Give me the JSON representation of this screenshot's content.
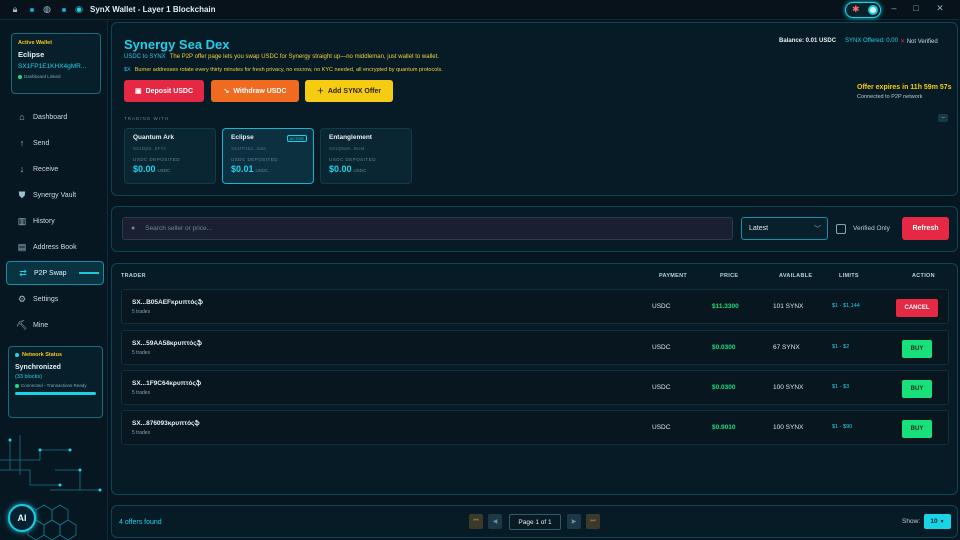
{
  "window": {
    "title": "SynX Wallet - Layer 1 Blockchain",
    "controls": [
      "–",
      "□",
      "✕"
    ]
  },
  "sidebar": {
    "wallet": {
      "label": "Active Wallet",
      "name": "Eclipse",
      "address": "SX1FP1E1KHX4gMR...",
      "status": "Dashboard Linked"
    },
    "items": [
      {
        "label": "Dashboard",
        "icon": "home-icon"
      },
      {
        "label": "Send",
        "icon": "send-icon"
      },
      {
        "label": "Receive",
        "icon": "receive-icon"
      },
      {
        "label": "Synergy Vault",
        "icon": "vault-icon"
      },
      {
        "label": "History",
        "icon": "history-icon"
      },
      {
        "label": "Address Book",
        "icon": "address-book-icon"
      },
      {
        "label": "P2P Swap",
        "icon": "swap-icon"
      },
      {
        "label": "Settings",
        "icon": "gear-icon"
      },
      {
        "label": "Mine",
        "icon": "pickaxe-icon"
      }
    ],
    "network": {
      "title": "Network Status",
      "status": "Synchronized",
      "blocks": "(33 blocks)",
      "connection": "Connected - Transactions Ready",
      "progress": 1.0
    },
    "ai_label": "AI"
  },
  "hero": {
    "title": "Synergy Sea Dex",
    "sub_tag": "USDC to SYNX",
    "sub_text": "The P2P offer page lets you swap USDC for Synergy straight up—no middleman, just wallet to wallet.",
    "sub2_tag": "$X",
    "sub2_text": "Burner addresses rotate every thirty minutes for fresh privacy, no escrow, no KYC needed, all encrypted by quantum protocols.",
    "deposit_label": "Deposit USDC",
    "withdraw_label": "Withdraw USDC",
    "add_offer_label": "Add SYNX Offer",
    "balance": "Balance: 0.01 USDC",
    "offered": "SYNX Offered: 0.00",
    "verified": "Not Verified",
    "expires": "Offer expires in 11h 59m 57s",
    "connected": "Connected to P2P network",
    "trading_with": "TRADING WITH",
    "collapse": "–",
    "wallets": [
      {
        "name": "Quantum Ark",
        "addr": "SX1ZtjNr...EFYs",
        "label": "USDC DEPOSITED",
        "value": "$0.00",
        "unit": "USDC",
        "badge": ""
      },
      {
        "name": "Eclipse",
        "addr": "SX1FP1E1...5aM",
        "label": "USDC DEPOSITED",
        "value": "$0.01",
        "unit": "USDC",
        "badge": "ACTIVE"
      },
      {
        "name": "Entanglement",
        "addr": "SX1Q9eW...9sHd",
        "label": "USDC DEPOSITED",
        "value": "$0.00",
        "unit": "USDC",
        "badge": ""
      }
    ]
  },
  "filters": {
    "search_placeholder": "Search seller or price...",
    "sort": "Latest",
    "verified_only": "Verified Only",
    "refresh": "Refresh"
  },
  "table": {
    "headers": [
      "TRADER",
      "PAYMENT",
      "PRICE",
      "AVAILABLE",
      "LIMITS",
      "ACTION"
    ],
    "rows": [
      {
        "trader": "SX...B05AEFκρυπτόςֆ",
        "trades": "5 trades",
        "payment": "USDC",
        "price": "$11.3300",
        "available": "101 SYNX",
        "limits": "$1 - $1,144",
        "action": "CANCEL"
      },
      {
        "trader": "SX...59AA58κρυπτόςֆ",
        "trades": "5 trades",
        "payment": "USDC",
        "price": "$0.0300",
        "available": "67 SYNX",
        "limits": "$1 - $2",
        "action": "BUY"
      },
      {
        "trader": "SX...1F9C64κρυπτόςֆ",
        "trades": "5 trades",
        "payment": "USDC",
        "price": "$0.0300",
        "available": "100 SYNX",
        "limits": "$1 - $3",
        "action": "BUY"
      },
      {
        "trader": "SX...876093κρυπτόςֆ",
        "trades": "5 trades",
        "payment": "USDC",
        "price": "$0.9010",
        "available": "100 SYNX",
        "limits": "$1 - $90",
        "action": "BUY"
      }
    ]
  },
  "pager": {
    "offers_found": "4 offers found",
    "page": "Page 1 of 1",
    "show_label": "Show:",
    "show_value": "10"
  },
  "colors": {
    "accent": "#1fd3e8",
    "danger": "#e52844",
    "warning": "#f6cc12",
    "success": "#18e07a"
  }
}
